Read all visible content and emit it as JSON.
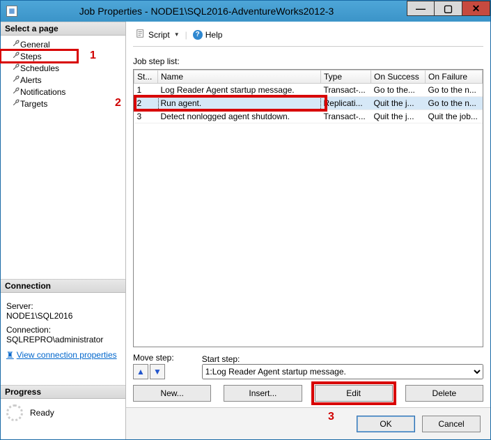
{
  "window": {
    "title": "Job Properties - NODE1\\SQL2016-AdventureWorks2012-3"
  },
  "annotations": {
    "a1": "1",
    "a2": "2",
    "a3": "3"
  },
  "left": {
    "select_page_header": "Select a page",
    "pages": [
      {
        "label": "General"
      },
      {
        "label": "Steps"
      },
      {
        "label": "Schedules"
      },
      {
        "label": "Alerts"
      },
      {
        "label": "Notifications"
      },
      {
        "label": "Targets"
      }
    ],
    "connection_header": "Connection",
    "server_label": "Server:",
    "server_value": "NODE1\\SQL2016",
    "connection_label": "Connection:",
    "connection_value": "SQLREPRO\\administrator",
    "view_conn_link": "View connection properties",
    "progress_header": "Progress",
    "progress_status": "Ready"
  },
  "toolbar": {
    "script_label": "Script",
    "help_label": "Help"
  },
  "main": {
    "list_label": "Job step list:",
    "columns": {
      "step": "St...",
      "name": "Name",
      "type": "Type",
      "on_success": "On Success",
      "on_failure": "On Failure"
    },
    "rows": [
      {
        "step": "1",
        "name": "Log Reader Agent startup message.",
        "type": "Transact-...",
        "on_success": "Go to the...",
        "on_failure": "Go to the n..."
      },
      {
        "step": "2",
        "name": "Run agent.",
        "type": "Replicati...",
        "on_success": "Quit the j...",
        "on_failure": "Go to the n..."
      },
      {
        "step": "3",
        "name": "Detect nonlogged agent shutdown.",
        "type": "Transact-...",
        "on_success": "Quit the j...",
        "on_failure": "Quit the job..."
      }
    ],
    "move_step_label": "Move step:",
    "start_step_label": "Start step:",
    "start_step_value": "1:Log Reader Agent startup message.",
    "buttons": {
      "new": "New...",
      "insert": "Insert...",
      "edit": "Edit",
      "delete": "Delete"
    }
  },
  "footer": {
    "ok": "OK",
    "cancel": "Cancel"
  }
}
